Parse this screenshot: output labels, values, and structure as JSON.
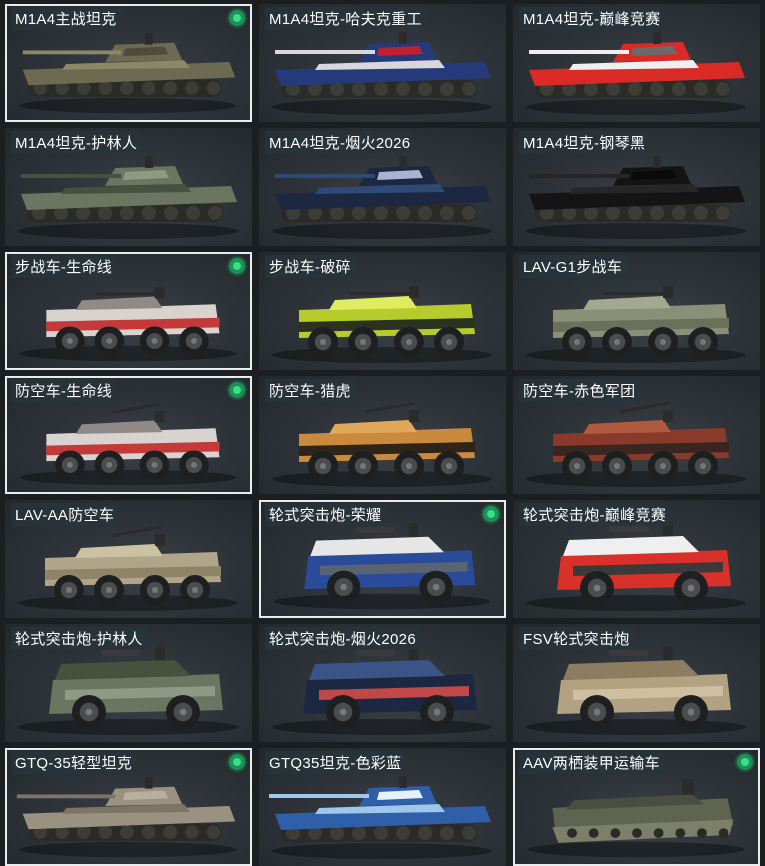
{
  "cards": [
    {
      "label": "M1A4主战坦克",
      "type": "tank",
      "selected": true,
      "equipped": true,
      "colors": [
        "#6d6a52",
        "#8b8868",
        "#4e4c3b"
      ]
    },
    {
      "label": "M1A4坦克-哈夫克重工",
      "type": "tank",
      "selected": false,
      "equipped": false,
      "colors": [
        "#243a7a",
        "#d8d8dc",
        "#c02030"
      ]
    },
    {
      "label": "M1A4坦克-巅峰竞赛",
      "type": "tank",
      "selected": false,
      "equipped": false,
      "colors": [
        "#d92a26",
        "#efefef",
        "#6a6a6a"
      ]
    },
    {
      "label": "M1A4坦克-护林人",
      "type": "tank",
      "selected": false,
      "equipped": false,
      "colors": [
        "#6b7560",
        "#48503e",
        "#8e9a84"
      ]
    },
    {
      "label": "M1A4坦克-烟火2026",
      "type": "tank",
      "selected": false,
      "equipped": false,
      "colors": [
        "#1c2842",
        "#2e4a78",
        "#a8b4d0"
      ]
    },
    {
      "label": "M1A4坦克-钢琴黑",
      "type": "tank",
      "selected": false,
      "equipped": false,
      "colors": [
        "#141414",
        "#262626",
        "#0a0a0a"
      ]
    },
    {
      "label": "步战车-生命线",
      "type": "ifv",
      "selected": true,
      "equipped": true,
      "colors": [
        "#d9d3d0",
        "#c43a3a",
        "#8f8a88"
      ]
    },
    {
      "label": "步战车-破碎",
      "type": "ifv",
      "selected": false,
      "equipped": false,
      "colors": [
        "#b7cc2c",
        "#2c3220",
        "#e0ec60"
      ]
    },
    {
      "label": "LAV-G1步战车",
      "type": "ifv",
      "selected": false,
      "equipped": false,
      "colors": [
        "#8a9078",
        "#6a705a",
        "#a4a890"
      ]
    },
    {
      "label": "防空车-生命线",
      "type": "aa",
      "selected": true,
      "equipped": true,
      "colors": [
        "#d9d3d0",
        "#c43a3a",
        "#8f8a88"
      ]
    },
    {
      "label": "防空车-猎虎",
      "type": "aa",
      "selected": false,
      "equipped": false,
      "colors": [
        "#c98a3e",
        "#2e2418",
        "#e0a858"
      ]
    },
    {
      "label": "防空车-赤色军团",
      "type": "aa",
      "selected": false,
      "equipped": false,
      "colors": [
        "#8a3a2a",
        "#3a2620",
        "#b05a40"
      ]
    },
    {
      "label": "LAV-AA防空车",
      "type": "aa",
      "selected": false,
      "equipped": false,
      "colors": [
        "#b0a588",
        "#8e8468",
        "#cbc2a4"
      ]
    },
    {
      "label": "轮式突击炮-荣耀",
      "type": "wheeled",
      "selected": true,
      "equipped": true,
      "colors": [
        "#2a4b9a",
        "#e6e6e6",
        "#5a6470"
      ]
    },
    {
      "label": "轮式突击炮-巅峰竞赛",
      "type": "wheeled",
      "selected": false,
      "equipped": false,
      "colors": [
        "#d9302a",
        "#efefef",
        "#3a3a3a"
      ]
    },
    {
      "label": "轮式突击炮-护林人",
      "type": "wheeled",
      "selected": false,
      "equipped": false,
      "colors": [
        "#6b7560",
        "#48503e",
        "#8e9a84"
      ]
    },
    {
      "label": "轮式突击炮-烟火2026",
      "type": "wheeled",
      "selected": false,
      "equipped": false,
      "colors": [
        "#1c2842",
        "#3a5488",
        "#c04848"
      ]
    },
    {
      "label": "FSV轮式突击炮",
      "type": "wheeled",
      "selected": false,
      "equipped": false,
      "colors": [
        "#b3a282",
        "#8c7c60",
        "#cdbfa0"
      ]
    },
    {
      "label": "GTQ-35轻型坦克",
      "type": "light",
      "selected": true,
      "equipped": true,
      "colors": [
        "#9a9180",
        "#7c7464",
        "#b8b09e"
      ]
    },
    {
      "label": "GTQ35坦克-色彩蓝",
      "type": "light",
      "selected": false,
      "equipped": false,
      "colors": [
        "#2f5fa8",
        "#9fc7ee",
        "#e8f2ff"
      ]
    },
    {
      "label": "AAV两栖装甲运输车",
      "type": "aav",
      "selected": true,
      "equipped": true,
      "colors": [
        "#5f6450",
        "#4a4e3e",
        "#7c8068"
      ]
    }
  ]
}
